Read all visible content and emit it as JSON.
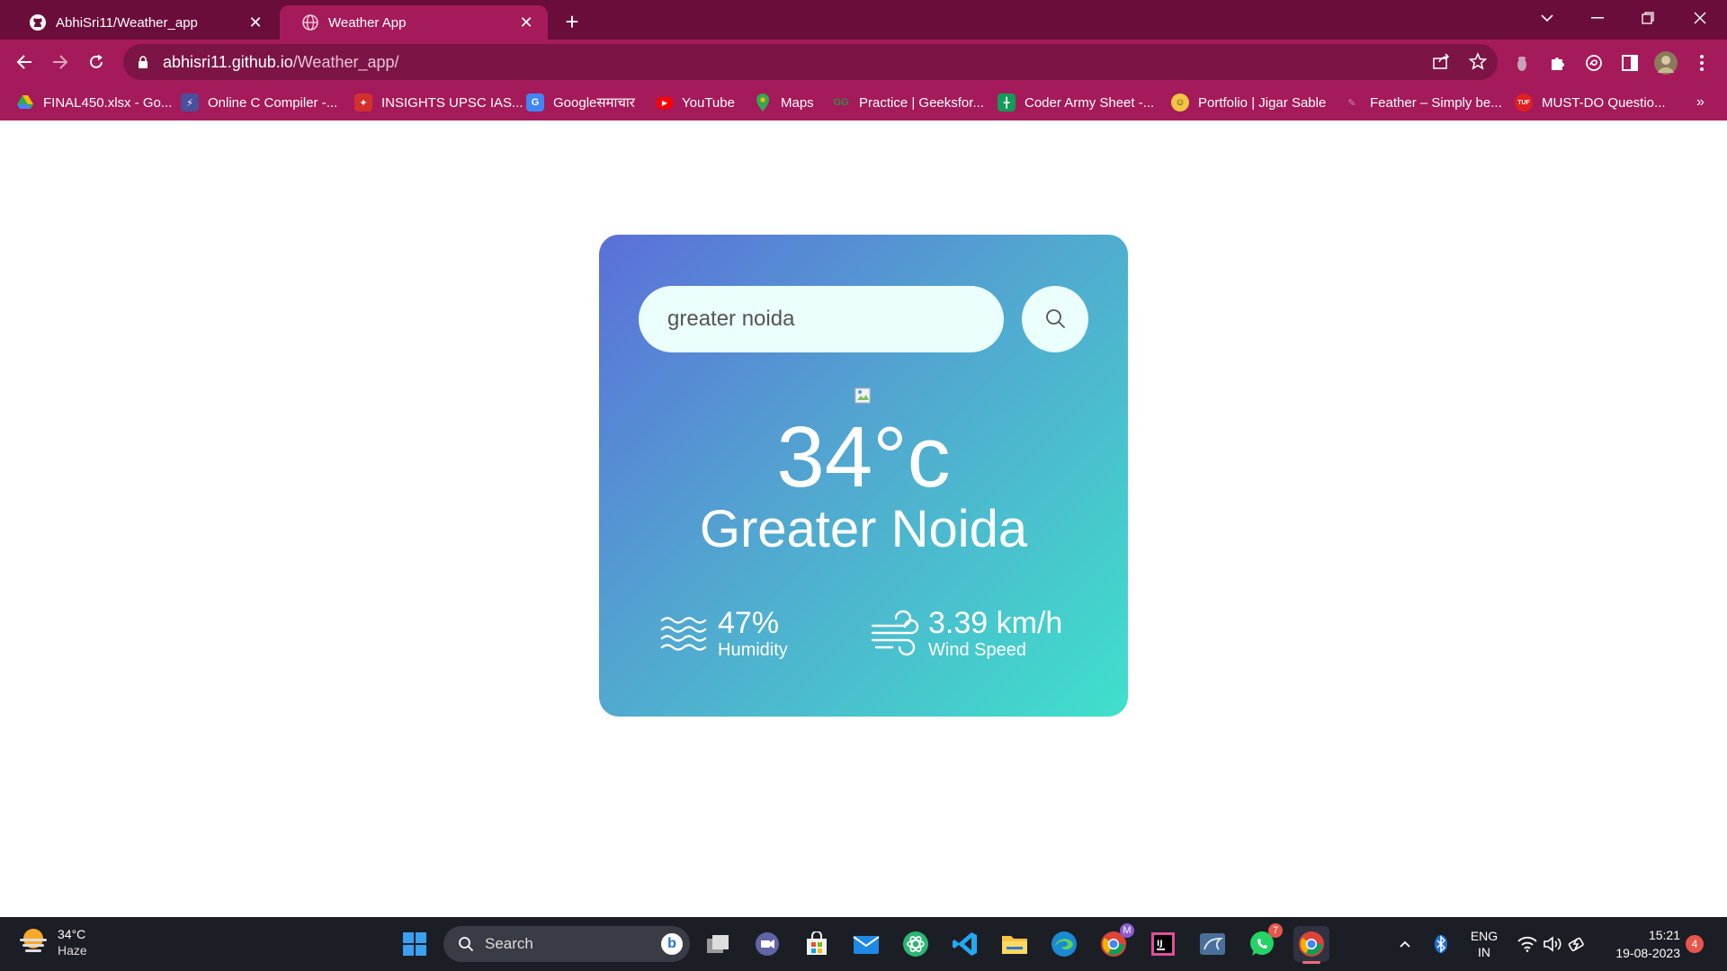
{
  "browser": {
    "tabs": [
      {
        "label": "AbhiSri11/Weather_app",
        "icon": "github-icon",
        "active": false
      },
      {
        "label": "Weather App",
        "icon": "globe-icon",
        "active": true
      }
    ],
    "new_tab_label": "+",
    "url_host": "abhisri11.github.io",
    "url_path": "/Weather_app/",
    "colors": {
      "tabstrip": "#6b0d3a",
      "toolbar": "#a51a5a",
      "omnibox": "#7d1446"
    },
    "bookmarks": [
      {
        "label": "FINAL450.xlsx - Go...",
        "icon": "google-drive-icon"
      },
      {
        "label": "Online C Compiler -...",
        "icon": "lightning-icon"
      },
      {
        "label": "INSIGHTS UPSC IAS...",
        "icon": "insights-icon"
      },
      {
        "label": "Googleसमाचार",
        "icon": "google-news-icon"
      },
      {
        "label": "YouTube",
        "icon": "youtube-icon"
      },
      {
        "label": "Maps",
        "icon": "maps-icon"
      },
      {
        "label": "Practice | Geeksfor...",
        "icon": "geeksforgeeks-icon"
      },
      {
        "label": "Coder Army Sheet -...",
        "icon": "sheets-icon"
      },
      {
        "label": "Portfolio | Jigar Sable",
        "icon": "avatar-icon"
      },
      {
        "label": "Feather – Simply be...",
        "icon": "feather-icon"
      },
      {
        "label": "MUST-DO Questio...",
        "icon": "tuf-icon"
      }
    ],
    "bookmarks_overflow": "»"
  },
  "weather_app": {
    "search_value": "greater noida",
    "temperature": "34°c",
    "city": "Greater Noida",
    "humidity_value": "47%",
    "humidity_label": "Humidity",
    "wind_value": "3.39 km/h",
    "wind_label": "Wind Speed",
    "gradient": [
      "#5b6fd9",
      "#3fe0cb"
    ]
  },
  "taskbar": {
    "weather_temp": "34°C",
    "weather_desc": "Haze",
    "search_label": "Search",
    "lang_line1": "ENG",
    "lang_line2": "IN",
    "time": "15:21",
    "date": "19-08-2023",
    "notification_count": "4",
    "whatsapp_badge": "7",
    "chrome_profile_badge": "M"
  }
}
